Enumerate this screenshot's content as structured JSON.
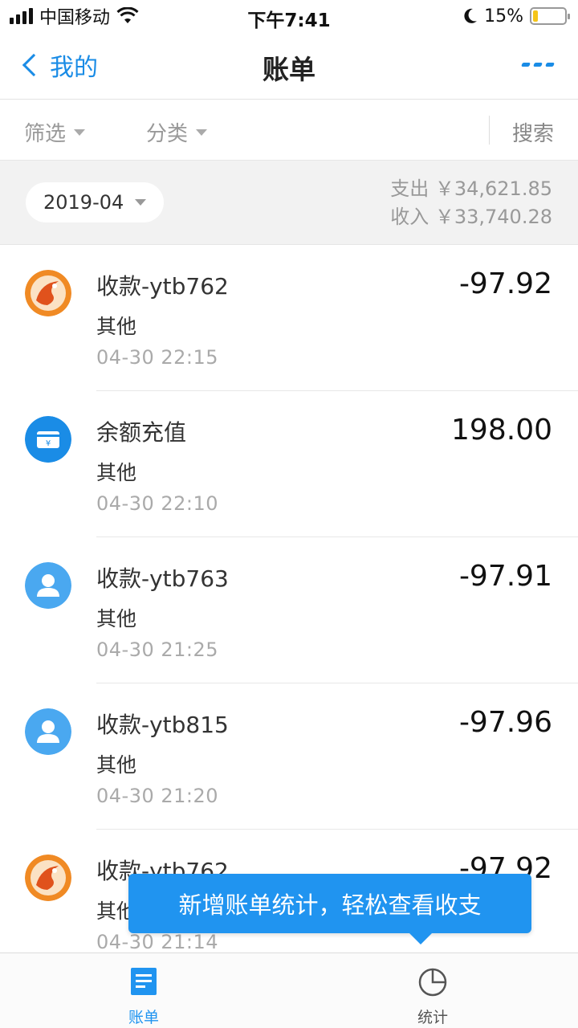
{
  "status_bar": {
    "carrier": "中国移动",
    "time": "下午7:41",
    "battery": "15%",
    "battery_level": 0.15
  },
  "nav": {
    "back_label": "我的",
    "title": "账单",
    "more_icon": "more-icon"
  },
  "filters": {
    "filter_label": "筛选",
    "category_label": "分类",
    "search_label": "搜索"
  },
  "month": {
    "selected": "2019-04",
    "expense": "支出 ￥34,621.85",
    "income": "收入 ￥33,740.28"
  },
  "transactions": [
    {
      "title": "收款-ytb762",
      "category": "其他",
      "time": "04-30  22:15",
      "amount": "-97.92",
      "icon": "bird-logo-icon"
    },
    {
      "title": "余额充值",
      "category": "其他",
      "time": "04-30  22:10",
      "amount": "198.00",
      "icon": "wallet-icon"
    },
    {
      "title": "收款-ytb763",
      "category": "其他",
      "time": "04-30  21:25",
      "amount": "-97.91",
      "icon": "person-icon"
    },
    {
      "title": "收款-ytb815",
      "category": "其他",
      "time": "04-30  21:20",
      "amount": "-97.96",
      "icon": "person-icon"
    },
    {
      "title": "收款-ytb762",
      "category": "其他",
      "time": "04-30  21:14",
      "amount": "-97.92",
      "icon": "bird-logo-icon"
    }
  ],
  "tooltip": "新增账单统计，轻松查看收支",
  "tabs": {
    "bill": "账单",
    "stats": "统计"
  },
  "colors": {
    "accent": "#2094f0",
    "battery": "#f5c518"
  }
}
